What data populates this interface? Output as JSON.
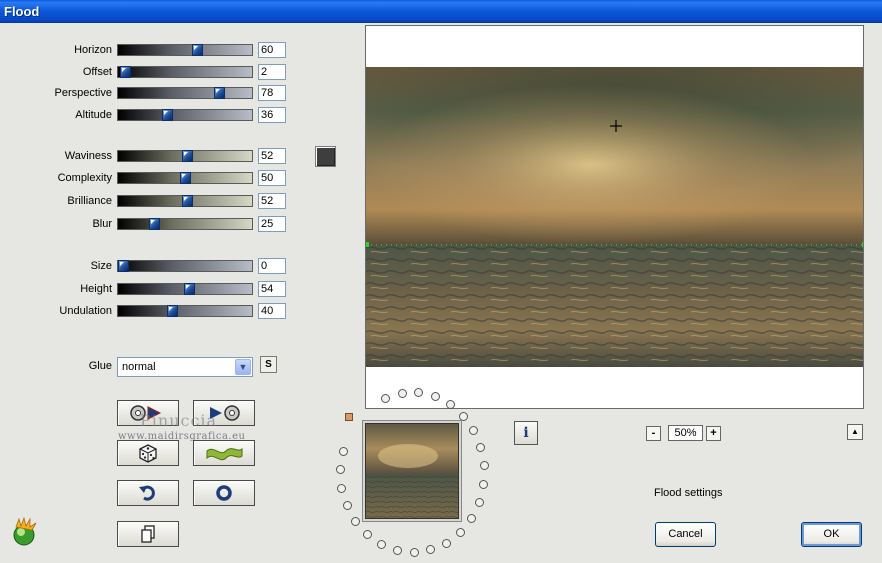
{
  "window": {
    "title": "Flood"
  },
  "sliders_group1": [
    {
      "label": "Horizon",
      "value": "60",
      "fraction": 0.6
    },
    {
      "label": "Offset",
      "value": "2",
      "fraction": 0.02
    },
    {
      "label": "Perspective",
      "value": "78",
      "fraction": 0.78
    },
    {
      "label": "Altitude",
      "value": "36",
      "fraction": 0.36
    }
  ],
  "sliders_group2": [
    {
      "label": "Waviness",
      "value": "52",
      "fraction": 0.52
    },
    {
      "label": "Complexity",
      "value": "50",
      "fraction": 0.5
    },
    {
      "label": "Brilliance",
      "value": "52",
      "fraction": 0.52
    },
    {
      "label": "Blur",
      "value": "25",
      "fraction": 0.25
    }
  ],
  "sliders_group3": [
    {
      "label": "Size",
      "value": "0",
      "fraction": 0.0
    },
    {
      "label": "Height",
      "value": "54",
      "fraction": 0.54
    },
    {
      "label": "Undulation",
      "value": "40",
      "fraction": 0.4
    }
  ],
  "glue": {
    "label": "Glue",
    "value": "normal",
    "reset_label": "S"
  },
  "color_swatch": {
    "color": "#3e3e3e"
  },
  "watermark": {
    "line1": "Pinuccia",
    "line2": "www.maidirsgrafica.eu"
  },
  "zoom": {
    "minus": "-",
    "value": "50%",
    "plus": "+"
  },
  "info_label": "i",
  "status_text": "Flood settings",
  "buttons": {
    "cancel": "Cancel",
    "ok": "OK"
  },
  "icons": {
    "preset_load": "disc-arrow-left-icon",
    "preset_save": "arrow-disc-right-icon",
    "randomize": "dice-icon",
    "wave": "wave-icon",
    "undo": "undo-arrow-icon",
    "reset": "ring-icon",
    "copy": "pages-icon"
  }
}
